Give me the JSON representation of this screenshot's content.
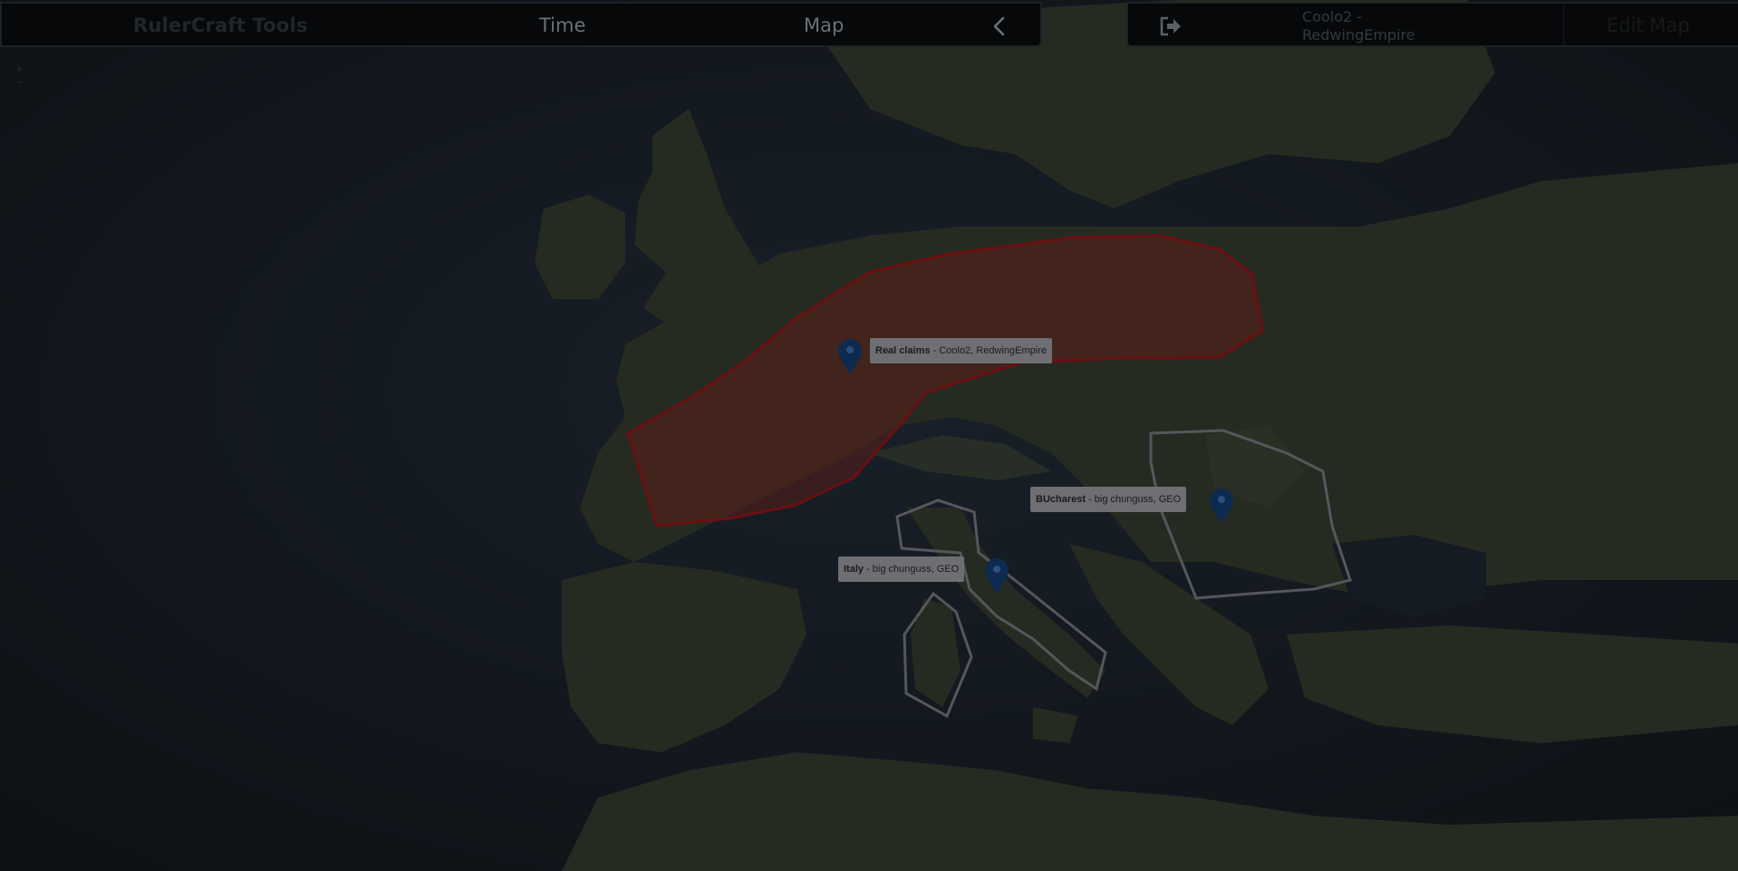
{
  "header": {
    "brand": "RulerCraft Tools",
    "nav_time": "Time",
    "nav_map": "Map",
    "collapse_icon": "chevron-left-icon",
    "logout_icon": "sign-out-icon",
    "user_line1": "Coolo2 -",
    "user_line2": "RedwingEmpire",
    "edit_map": "Edit Map"
  },
  "map": {
    "markers": [
      {
        "title": "Real claims",
        "owners": " - Coolo2, RedwingEmpire"
      },
      {
        "title": "BUcharest",
        "owners": " - big chunguss, GEO"
      },
      {
        "title": "Italy",
        "owners": " - big chunguss, GEO"
      }
    ],
    "zoom_plus": "+",
    "zoom_minus": "−",
    "colors": {
      "claim_fill": "#5a1f1a",
      "claim_stroke": "#6b0f12",
      "region_stroke": "#55575a",
      "pin": "#0e2a4f",
      "sea": "#141a22",
      "land": "#23291f"
    }
  }
}
